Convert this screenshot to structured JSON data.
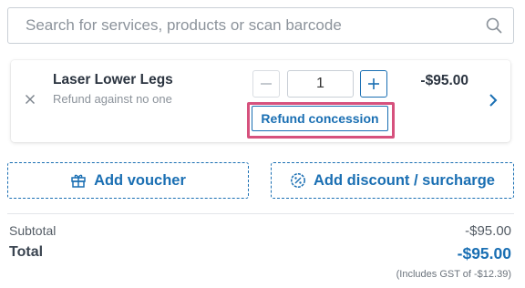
{
  "search": {
    "placeholder": "Search for services, products or scan barcode"
  },
  "line_item": {
    "name": "Laser Lower Legs",
    "subtitle": "Refund against no one",
    "quantity": "1",
    "price": "-$95.00",
    "refund_button_label": "Refund concession"
  },
  "actions": {
    "voucher_label": "Add voucher",
    "discount_label": "Add discount / surcharge"
  },
  "totals": {
    "subtotal_label": "Subtotal",
    "subtotal_value": "-$95.00",
    "total_label": "Total",
    "total_value": "-$95.00",
    "gst_note": "(Includes GST of -$12.39)"
  },
  "colors": {
    "accent": "#1a6fb3",
    "highlight": "#d6517d"
  },
  "icons": {
    "search": "search-icon",
    "remove": "close-icon",
    "minus": "minus-icon",
    "plus": "plus-icon",
    "next": "chevron-right-icon",
    "voucher": "gift-icon",
    "discount": "percent-badge-icon"
  }
}
